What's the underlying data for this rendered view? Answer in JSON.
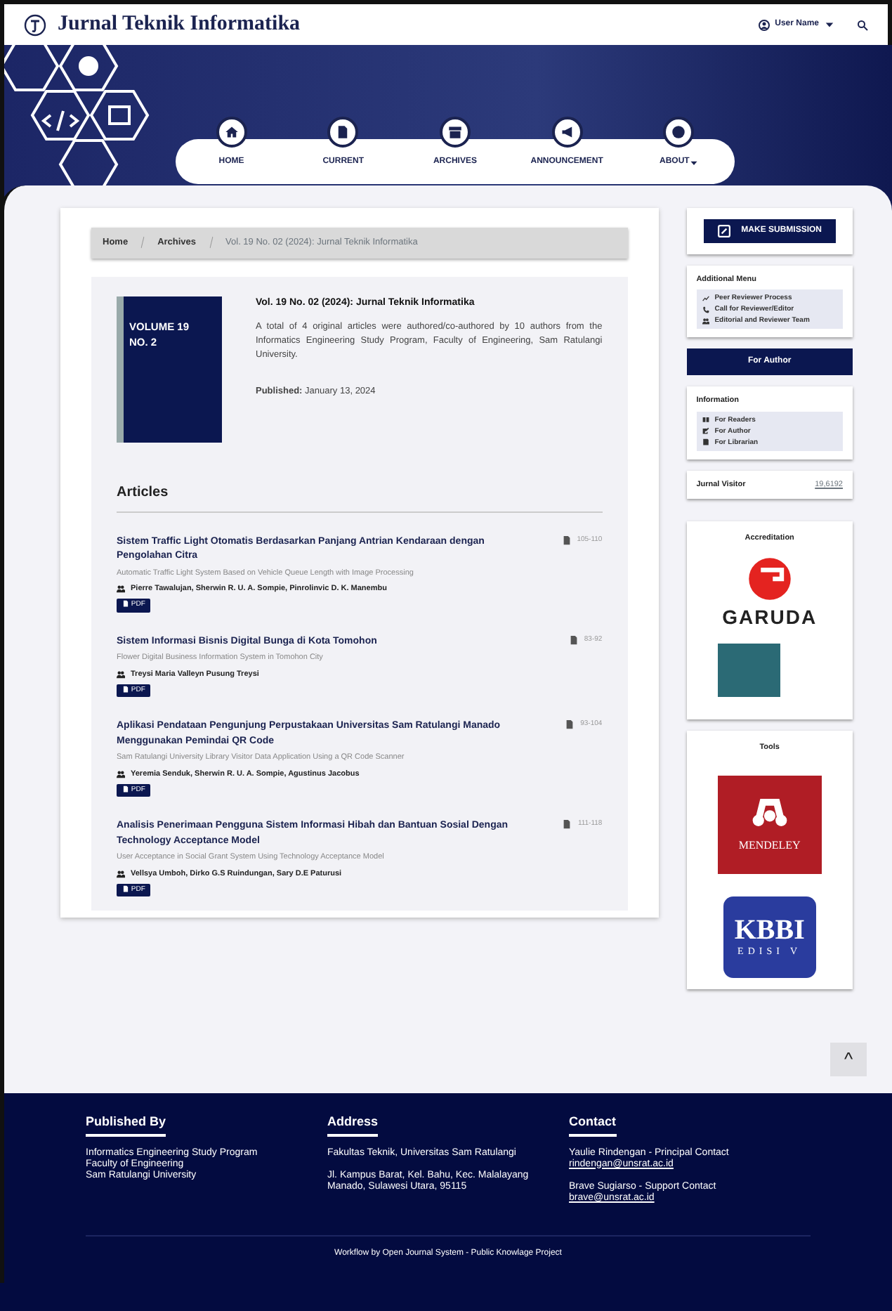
{
  "site_title": "Jurnal Teknik Informatika",
  "user_menu": {
    "label": "User Name"
  },
  "nav": [
    {
      "label": "HOME",
      "dropdown": false
    },
    {
      "label": "CURRENT",
      "dropdown": false
    },
    {
      "label": "ARCHIVES",
      "dropdown": false
    },
    {
      "label": "ANNOUNCEMENT",
      "dropdown": false
    },
    {
      "label": "ABOUT",
      "dropdown": true
    }
  ],
  "breadcrumb": [
    "Home",
    "Archives",
    "Vol. 19 No. 02 (2024): Jurnal Teknik Informatika"
  ],
  "issue": {
    "cover": {
      "line_1": "VOLUME 19",
      "line_2": "NO. 2"
    },
    "title": "Vol. 19 No. 02 (2024): Jurnal Teknik Informatika",
    "description": "A total of 4 original articles were authored/co-authored by 10 authors from the Informatics Engineering Study Program, Faculty of Engineering, Sam Ratulangi University.",
    "published_label": "Published:",
    "published_date": "January 13, 2024"
  },
  "articles_heading": "Articles",
  "articles": [
    {
      "title": "Sistem Traffic Light Otomatis Berdasarkan Panjang Antrian Kendaraan dengan Pengolahan Citra",
      "subtitle": "Automatic Traffic Light System Based on Vehicle Queue Length with Image Processing",
      "authors": "Pierre Tawalujan, Sherwin R. U. A. Sompie, Pinrolinvic D. K. Manembu",
      "pages": "105-110",
      "galley": "PDF"
    },
    {
      "title": "Sistem Informasi Bisnis Digital Bunga di Kota Tomohon",
      "subtitle": "Flower Digital Business Information System in Tomohon City",
      "authors": "Treysi Maria Valleyn Pusung Treysi",
      "pages": "83-92",
      "galley": "PDF"
    },
    {
      "title": "Aplikasi Pendataan Pengunjung Perpustakaan Universitas Sam Ratulangi Manado Menggunakan Pemindai QR Code",
      "subtitle": "Sam Ratulangi University Library Visitor Data  Application Using a QR Code Scanner",
      "authors": "Yeremia Senduk, Sherwin R. U. A. Sompie, Agustinus Jacobus",
      "pages": "93-104",
      "galley": "PDF"
    },
    {
      "title": "Analisis Penerimaan Pengguna Sistem Informasi Hibah dan Bantuan Sosial Dengan  Technology Acceptance Model",
      "subtitle": "User Acceptance in Social Grant System Using Technology Acceptance Model",
      "authors": "Vellsya Umboh, Dirko G.S Ruindungan, Sary D.E Paturusi",
      "pages": "111-118",
      "galley": "PDF"
    }
  ],
  "sidebar": {
    "submission_button": "MAKE SUBMISSION",
    "additional_menu": {
      "title": "Additional Menu",
      "items": [
        {
          "label": "Peer Reviewer Process"
        },
        {
          "label": "Call for Reviewer/Editor"
        },
        {
          "label": "Editorial and Reviewer Team"
        }
      ]
    },
    "for_author": "For Author",
    "information": {
      "title": "Information",
      "items": [
        {
          "label": "For Readers"
        },
        {
          "label": "For Author"
        },
        {
          "label": "For Librarian"
        }
      ]
    },
    "visitor": {
      "label": "Jurnal Visitor",
      "count": "19,6192"
    },
    "accreditation": {
      "title": "Accreditation",
      "garuda": "GARUDA"
    },
    "tools": {
      "title": "Tools",
      "mendeley": "MENDELEY",
      "kbbi": "KBBI",
      "kbbi_edition": "EDISI V"
    }
  },
  "back_to_top": "^",
  "footer": {
    "columns": [
      {
        "title": "Published By",
        "blocks": [
          {
            "lines": [
              "Informatics Engineering Study Program",
              "Faculty of Engineering",
              "Sam Ratulangi University"
            ]
          }
        ]
      },
      {
        "title": "Address",
        "blocks": [
          {
            "lines": [
              "Fakultas Teknik, Universitas Sam Ratulangi"
            ]
          },
          {
            "lines": [
              "Jl. Kampus Barat, Kel. Bahu, Kec. Malalayang",
              "Manado, Sulawesi Utara, 95115"
            ]
          }
        ]
      },
      {
        "title": "Contact",
        "blocks": [
          {
            "lines": [
              "Yaulie Rindengan - Principal Contact"
            ],
            "email": "rindengan@unsrat.ac.id"
          },
          {
            "lines": [
              "Brave Sugiarso - Support Contact"
            ],
            "email": "brave@unsrat.ac.id"
          }
        ]
      }
    ],
    "credit": "Workflow by Open Journal System - Public Knowlage Project"
  }
}
